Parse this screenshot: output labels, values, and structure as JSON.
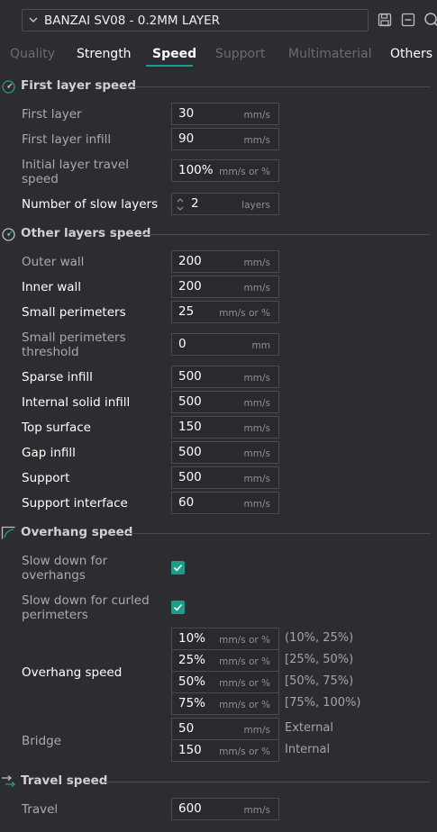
{
  "preset": {
    "name": "BANZAI SV08 - 0.2MM LAYER"
  },
  "tabs": [
    "Quality",
    "Strength",
    "Speed",
    "Support",
    "Multimaterial",
    "Others"
  ],
  "sections": {
    "first_layer": "First layer speed",
    "other_layers": "Other layers speed",
    "overhang": "Overhang speed",
    "travel": "Travel speed"
  },
  "fields": {
    "first_layer": {
      "label": "First layer",
      "value": "30",
      "unit": "mm/s"
    },
    "first_layer_infill": {
      "label": "First layer infill",
      "value": "90",
      "unit": "mm/s"
    },
    "initial_travel": {
      "label_line1": "Initial layer travel",
      "label_line2": "speed",
      "value": "100%",
      "unit": "mm/s or %"
    },
    "slow_layers": {
      "label": "Number of slow layers",
      "value": "2",
      "unit": "layers"
    },
    "outer_wall": {
      "label": "Outer wall",
      "value": "200",
      "unit": "mm/s"
    },
    "inner_wall": {
      "label": "Inner wall",
      "value": "200",
      "unit": "mm/s"
    },
    "small_perimeters": {
      "label": "Small perimeters",
      "value": "25",
      "unit": "mm/s or %"
    },
    "small_perimeters_threshold": {
      "label_line1": "Small perimeters",
      "label_line2": "threshold",
      "value": "0",
      "unit": "mm"
    },
    "sparse_infill": {
      "label": "Sparse infill",
      "value": "500",
      "unit": "mm/s"
    },
    "internal_solid_infill": {
      "label": "Internal solid infill",
      "value": "500",
      "unit": "mm/s"
    },
    "top_surface": {
      "label": "Top surface",
      "value": "150",
      "unit": "mm/s"
    },
    "gap_infill": {
      "label": "Gap infill",
      "value": "500",
      "unit": "mm/s"
    },
    "support": {
      "label": "Support",
      "value": "500",
      "unit": "mm/s"
    },
    "support_interface": {
      "label": "Support interface",
      "value": "60",
      "unit": "mm/s"
    },
    "slow_overhangs": {
      "label_line1": "Slow down for",
      "label_line2": "overhangs",
      "checked": true
    },
    "slow_curled": {
      "label_line1": "Slow down for curled",
      "label_line2": "perimeters",
      "checked": true
    },
    "overhang_speed": {
      "label": "Overhang speed",
      "rows": [
        {
          "value": "10%",
          "unit": "mm/s or %",
          "range": "(10%, 25%)"
        },
        {
          "value": "25%",
          "unit": "mm/s or %",
          "range": "[25%, 50%)"
        },
        {
          "value": "50%",
          "unit": "mm/s or %",
          "range": "[50%, 75%)"
        },
        {
          "value": "75%",
          "unit": "mm/s or %",
          "range": "[75%, 100%)"
        }
      ]
    },
    "bridge": {
      "label": "Bridge",
      "rows": [
        {
          "value": "50",
          "unit": "mm/s",
          "note": "External"
        },
        {
          "value": "150",
          "unit": "mm/s or %",
          "note": "Internal"
        }
      ]
    },
    "travel": {
      "label": "Travel",
      "value": "600",
      "unit": "mm/s"
    }
  },
  "icons": {
    "preset_dropdown": "chevron-down-icon",
    "save": "save-icon",
    "remove": "minus-box-icon",
    "search": "search-icon"
  },
  "colors": {
    "accent": "#1b9d8a",
    "background": "#2d2d31"
  }
}
